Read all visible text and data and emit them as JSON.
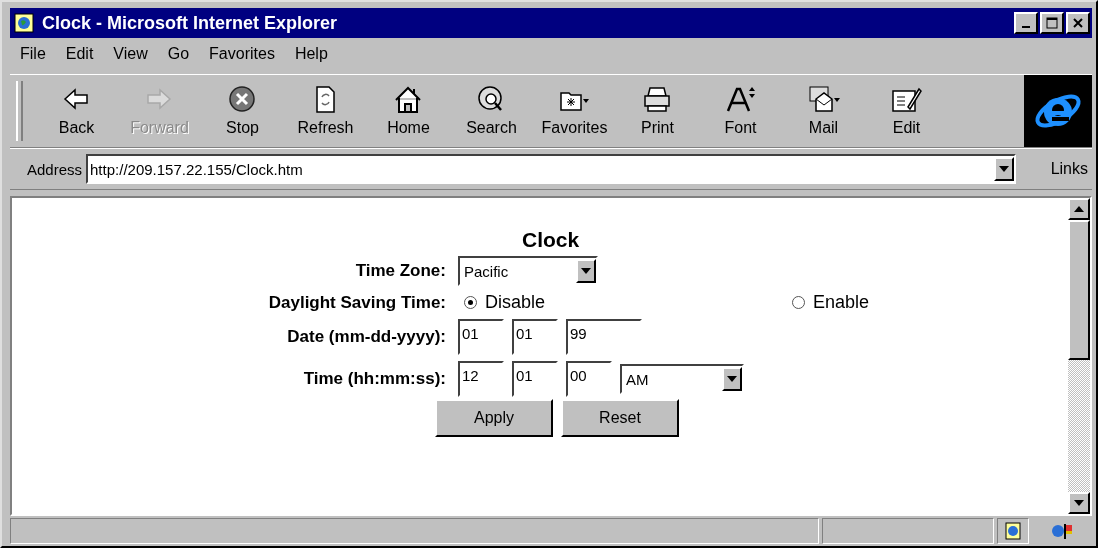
{
  "window": {
    "title": "Clock - Microsoft Internet Explorer"
  },
  "menu": [
    "File",
    "Edit",
    "View",
    "Go",
    "Favorites",
    "Help"
  ],
  "toolbar": [
    {
      "kind": "back",
      "label": "Back",
      "disabled": false
    },
    {
      "kind": "forward",
      "label": "Forward",
      "disabled": true
    },
    {
      "kind": "stop",
      "label": "Stop",
      "disabled": false
    },
    {
      "kind": "refresh",
      "label": "Refresh",
      "disabled": false
    },
    {
      "kind": "home",
      "label": "Home",
      "disabled": false
    },
    {
      "kind": "search",
      "label": "Search",
      "disabled": false
    },
    {
      "kind": "favorites",
      "label": "Favorites",
      "disabled": false
    },
    {
      "kind": "print",
      "label": "Print",
      "disabled": false
    },
    {
      "kind": "font",
      "label": "Font",
      "disabled": false
    },
    {
      "kind": "mail",
      "label": "Mail",
      "disabled": false
    },
    {
      "kind": "edit",
      "label": "Edit",
      "disabled": false
    }
  ],
  "address_bar": {
    "label": "Address",
    "url": "http://209.157.22.155/Clock.htm",
    "links": "Links"
  },
  "page": {
    "heading": "Clock",
    "time_zone": {
      "label": "Time Zone:",
      "value": "Pacific"
    },
    "dst": {
      "label": "Daylight Saving Time:",
      "options": [
        {
          "label": "Disable",
          "selected": true
        },
        {
          "label": "Enable",
          "selected": false
        }
      ]
    },
    "date": {
      "label": "Date (mm-dd-yyyy):",
      "fields": [
        "01",
        "01",
        "99"
      ]
    },
    "time": {
      "label": "Time (hh:mm:ss):",
      "fields": [
        "12",
        "01",
        "00"
      ],
      "period": "AM"
    },
    "buttons": [
      "Apply",
      "Reset"
    ]
  }
}
